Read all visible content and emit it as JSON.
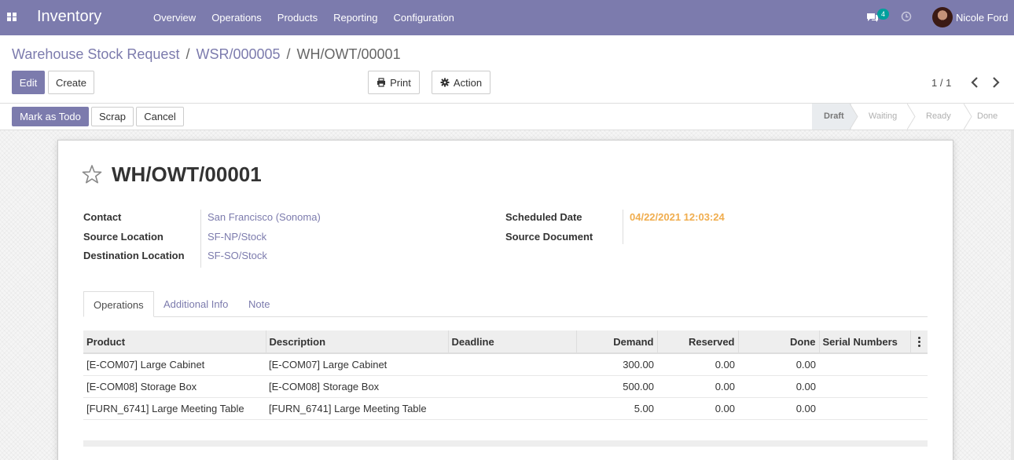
{
  "navbar": {
    "app_name": "Inventory",
    "menu": [
      "Overview",
      "Operations",
      "Products",
      "Reporting",
      "Configuration"
    ],
    "message_count": "4",
    "user_name": "Nicole Ford",
    "bg_color": "#7c7bad"
  },
  "breadcrumb": {
    "root": "Warehouse Stock Request",
    "parent": "WSR/000005",
    "current": "WH/OWT/00001",
    "separator": "/"
  },
  "toolbar": {
    "edit_label": "Edit",
    "create_label": "Create",
    "print_label": "Print",
    "action_label": "Action",
    "pager": "1 / 1"
  },
  "statusbar": {
    "mark_todo_label": "Mark as Todo",
    "scrap_label": "Scrap",
    "cancel_label": "Cancel",
    "stages": [
      "Draft",
      "Waiting",
      "Ready",
      "Done"
    ],
    "active_stage": "Draft"
  },
  "record": {
    "title": "WH/OWT/00001",
    "contact_label": "Contact",
    "contact_value": "San Francisco (Sonoma)",
    "source_location_label": "Source Location",
    "source_location_value": "SF-NP/Stock",
    "destination_location_label": "Destination Location",
    "destination_location_value": "SF-SO/Stock",
    "scheduled_date_label": "Scheduled Date",
    "scheduled_date_value": "04/22/2021 12:03:24",
    "source_document_label": "Source Document",
    "source_document_value": ""
  },
  "tabs": [
    "Operations",
    "Additional Info",
    "Note"
  ],
  "table": {
    "columns": [
      "Product",
      "Description",
      "Deadline",
      "Demand",
      "Reserved",
      "Done",
      "Serial Numbers"
    ],
    "rows": [
      {
        "product": "[E-COM07] Large Cabinet",
        "description": "[E-COM07] Large Cabinet",
        "deadline": "",
        "demand": "300.00",
        "reserved": "0.00",
        "done": "0.00",
        "serials": ""
      },
      {
        "product": "[E-COM08] Storage Box",
        "description": "[E-COM08] Storage Box",
        "deadline": "",
        "demand": "500.00",
        "reserved": "0.00",
        "done": "0.00",
        "serials": ""
      },
      {
        "product": "[FURN_6741] Large Meeting Table",
        "description": "[FURN_6741] Large Meeting Table",
        "deadline": "",
        "demand": "5.00",
        "reserved": "0.00",
        "done": "0.00",
        "serials": ""
      }
    ]
  }
}
